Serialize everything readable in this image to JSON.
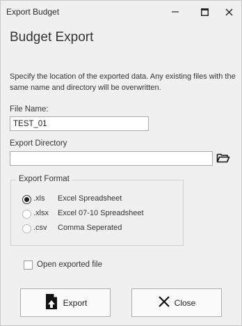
{
  "window": {
    "title": "Export Budget"
  },
  "heading": "Budget Export",
  "description": "Specify the location of the exported data. Any existing files with the same name and directory will be overwritten.",
  "file_name": {
    "label": "File Name:",
    "value": "TEST_01"
  },
  "export_directory": {
    "label": "Export Directory",
    "value": ""
  },
  "export_format": {
    "title": "Export Format",
    "options": [
      {
        "ext": ".xls",
        "label": "Excel Spreadsheet",
        "selected": true
      },
      {
        "ext": ".xlsx",
        "label": "Excel 07-10 Spreadsheet",
        "selected": false
      },
      {
        "ext": ".csv",
        "label": "Comma Seperated",
        "selected": false
      }
    ]
  },
  "open_exported_file": {
    "label": "Open exported file",
    "checked": false
  },
  "buttons": {
    "export_label": "Export",
    "close_label": "Close"
  },
  "icons": {
    "minimize": "minimize-icon",
    "maximize": "maximize-icon",
    "close": "close-icon",
    "browse": "folder-open-icon",
    "export": "export-file-icon",
    "close_button": "x-icon"
  }
}
